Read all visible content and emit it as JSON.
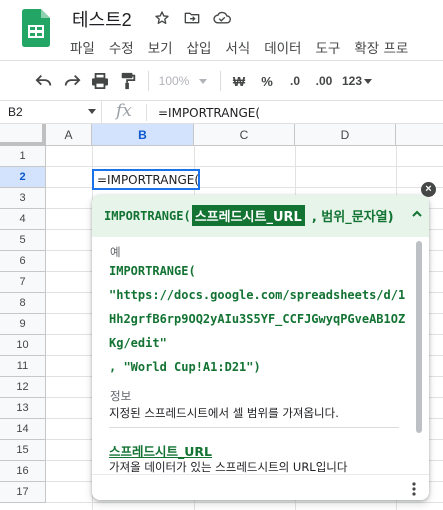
{
  "header": {
    "title": "테스트2",
    "menu": [
      "파일",
      "수정",
      "보기",
      "삽입",
      "서식",
      "데이터",
      "도구",
      "확장 프로"
    ]
  },
  "toolbar": {
    "zoom": "100%",
    "currency": "₩",
    "percent": "%",
    "decimal_decrease": ".0",
    "decimal_increase": ".00",
    "format_more": "123"
  },
  "formula_bar": {
    "name_box": "B2",
    "fx": "fx",
    "formula": "=IMPORTRANGE("
  },
  "grid": {
    "columns": [
      "A",
      "B",
      "C",
      "D"
    ],
    "rows": [
      "1",
      "2",
      "3",
      "4",
      "5",
      "6",
      "7",
      "8",
      "9",
      "10",
      "11",
      "12",
      "13",
      "14",
      "15",
      "16",
      "17"
    ],
    "active_cell_text": "=IMPORTRANGE("
  },
  "help": {
    "fn": "IMPORTRANGE(",
    "arg_active": "스프레드시트_URL",
    "arg_rest": ", 범위_문자열)",
    "example_label": "예",
    "example_lines": [
      "IMPORTRANGE(",
      "\"https://docs.google.com/spreadsheets/d/1",
      "Hh2grfB6rp9OQ2yAIu3S5YF_CCFJGwyqPGveAB1OZ",
      "Kg/edit\"",
      ", \"World Cup!A1:D21\")"
    ],
    "summary_label": "정보",
    "summary_text": "지정된 스프레드시트에서 셀 범위를 가져옵니다.",
    "arg_title": "스프레드시트_URL",
    "arg_desc": "가져올 데이터가 있는 스프레드시트의 URL입니다"
  },
  "colors": {
    "accent_green": "#137333",
    "selection_blue": "#1a73e8",
    "help_header_bg": "#e6f4ea"
  }
}
